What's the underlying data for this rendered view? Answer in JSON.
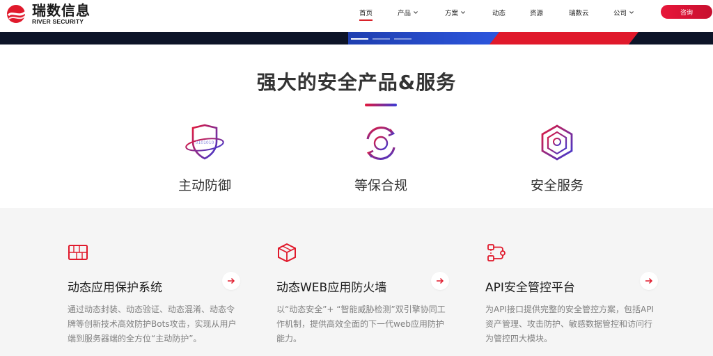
{
  "brand": {
    "name_cn": "瑞数信息",
    "name_en": "RIVER SECURITY",
    "accent": "#d9222a"
  },
  "nav": {
    "items": [
      {
        "label": "首页",
        "active": true,
        "dropdown": false
      },
      {
        "label": "产品",
        "active": false,
        "dropdown": true
      },
      {
        "label": "方案",
        "active": false,
        "dropdown": true
      },
      {
        "label": "动态",
        "active": false,
        "dropdown": false
      },
      {
        "label": "资源",
        "active": false,
        "dropdown": false
      },
      {
        "label": "瑞数云",
        "active": false,
        "dropdown": false
      },
      {
        "label": "公司",
        "active": false,
        "dropdown": true
      }
    ],
    "consult_label": "咨询"
  },
  "carousel": {
    "slide_count": 3,
    "active_index": 0
  },
  "products": {
    "title": "强大的安全产品&服务",
    "features": [
      {
        "label": "主动防御",
        "icon": "shield-orbit-icon"
      },
      {
        "label": "等保合规",
        "icon": "target-refresh-icon"
      },
      {
        "label": "安全服务",
        "icon": "hexagon-bulb-icon"
      }
    ]
  },
  "cards": [
    {
      "icon": "firewall-icon",
      "title": "动态应用保护系统",
      "desc": "通过动态封装、动态验证、动态混淆、动态令牌等创新技术高效防护Bots攻击，实现从用户端到服务器端的全方位“主动防护”。"
    },
    {
      "icon": "cube-box-icon",
      "title": "动态WEB应用防火墙",
      "desc": "以“动态安全”+ “智能威胁检测”双引擎协同工作机制，提供高效全面的下一代web应用防护能力。"
    },
    {
      "icon": "api-flow-icon",
      "title": "API安全管控平台",
      "desc": "为API接口提供完整的安全管控方案，包括API资产管理、攻击防护、敏感数据管控和访问行为管控四大模块。"
    }
  ]
}
